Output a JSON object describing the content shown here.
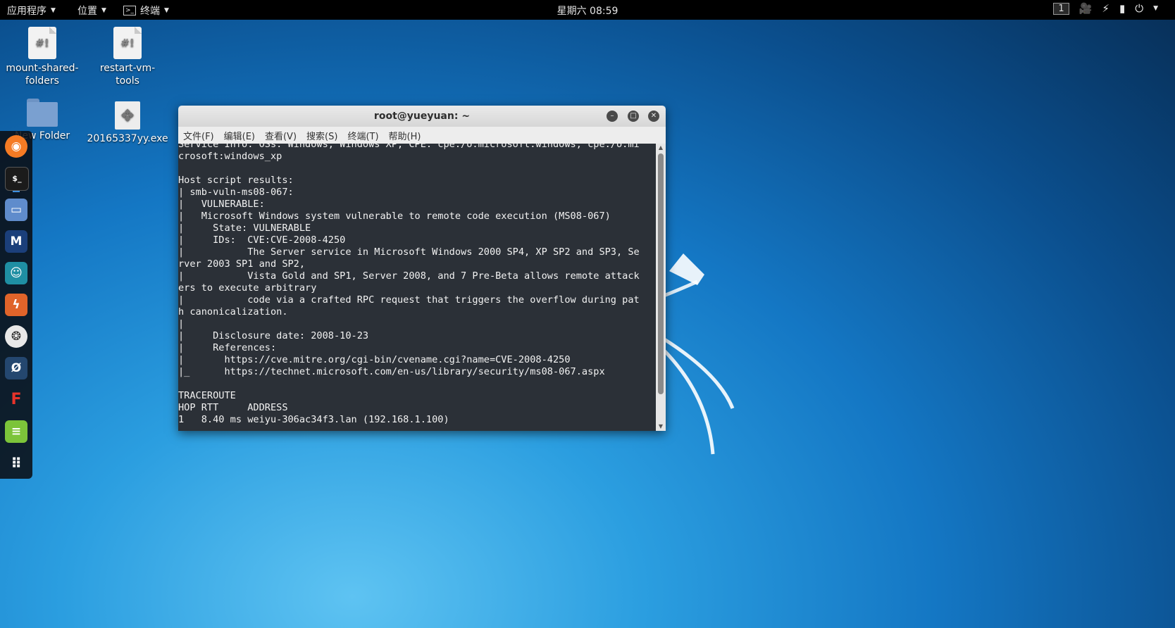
{
  "topbar": {
    "apps_label": "应用程序",
    "places_label": "位置",
    "terminal_label": "终端",
    "clock": "星期六 08:59",
    "workspace": "1"
  },
  "desktop": {
    "icons": [
      {
        "label": "mount-shared-\nfolders",
        "icon": "script-file-icon"
      },
      {
        "label": "restart-vm-\ntools",
        "icon": "script-file-icon"
      },
      {
        "label": "New Folder",
        "icon": "folder-icon"
      },
      {
        "label": "20165337yy.exe",
        "icon": "exe-file-icon"
      }
    ]
  },
  "dock": {
    "items": [
      "firefox-icon",
      "terminal-icon",
      "files-icon",
      "metasploit-icon",
      "armitage-icon",
      "burpsuite-icon",
      "maltego-icon",
      "beef-icon",
      "faraday-icon",
      "leafpad-icon",
      "show-apps-icon"
    ]
  },
  "terminal": {
    "title": "root@yueyuan: ~",
    "menu": [
      "文件(F)",
      "编辑(E)",
      "查看(V)",
      "搜索(S)",
      "终端(T)",
      "帮助(H)"
    ],
    "output": "Service Info: OSs: Windows, Windows XP; CPE: cpe:/o:microsoft:windows, cpe:/o:mi\ncrosoft:windows_xp\n\nHost script results:\n| smb-vuln-ms08-067:\n|   VULNERABLE:\n|   Microsoft Windows system vulnerable to remote code execution (MS08-067)\n|     State: VULNERABLE\n|     IDs:  CVE:CVE-2008-4250\n|           The Server service in Microsoft Windows 2000 SP4, XP SP2 and SP3, Se\nrver 2003 SP1 and SP2,\n|           Vista Gold and SP1, Server 2008, and 7 Pre-Beta allows remote attack\ners to execute arbitrary\n|           code via a crafted RPC request that triggers the overflow during pat\nh canonicalization.\n|\n|     Disclosure date: 2008-10-23\n|     References:\n|       https://cve.mitre.org/cgi-bin/cvename.cgi?name=CVE-2008-4250\n|_      https://technet.microsoft.com/en-us/library/security/ms08-067.aspx\n\nTRACEROUTE\nHOP RTT     ADDRESS\n1   8.40 ms weiyu-306ac34f3.lan (192.168.1.100)"
  }
}
